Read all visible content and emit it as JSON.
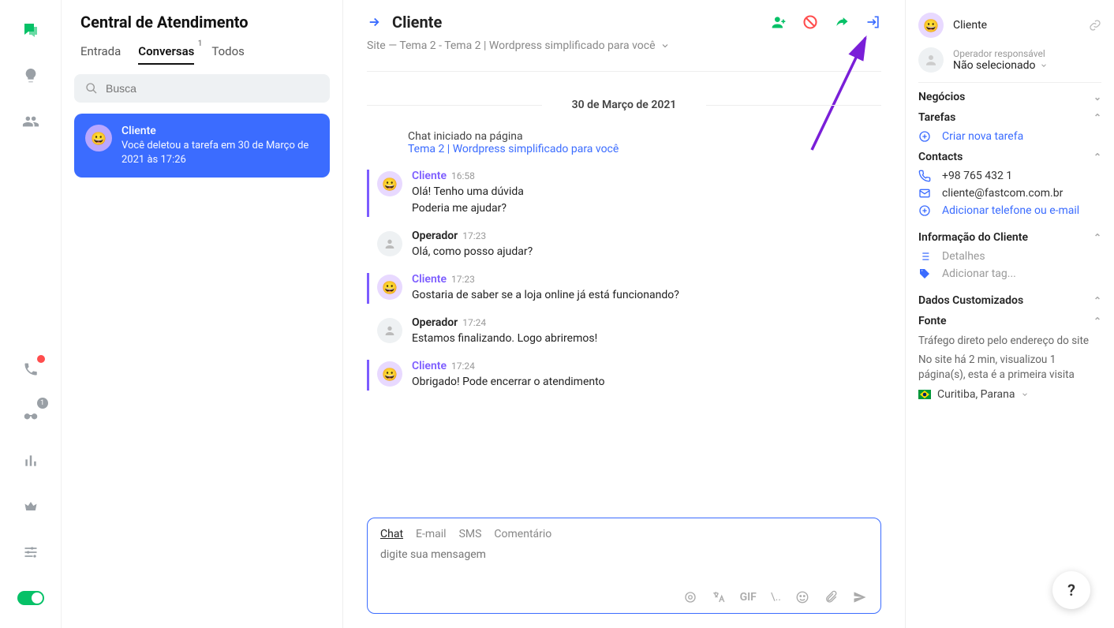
{
  "rail": {
    "binoculars_badge": "1"
  },
  "convs": {
    "title": "Central de Atendimento",
    "tabs": {
      "inbox": "Entrada",
      "conversations": "Conversas",
      "conv_badge": "1",
      "all": "Todos"
    },
    "search_placeholder": "Busca",
    "item": {
      "name": "Cliente",
      "preview": "Você deletou a tarefa em 30 de Março de 2021 às 17:26"
    }
  },
  "main": {
    "title": "Cliente",
    "breadcrumb": "Site — Tema 2 - Tema 2 | Wordpress simplificado para você",
    "date": "30 de Março de 2021",
    "sys": {
      "label": "Chat iniciado na página",
      "link": "Tema 2 | Wordpress simplificado para você"
    },
    "messages": [
      {
        "author": "Cliente",
        "role": "client",
        "time": "16:58",
        "text": "Olá! Tenho uma dúvida\nPoderia me ajudar?"
      },
      {
        "author": "Operador",
        "role": "operator",
        "time": "17:23",
        "text": "Olá, como posso ajudar?"
      },
      {
        "author": "Cliente",
        "role": "client",
        "time": "17:23",
        "text": "Gostaria de saber se a loja online já está funcionando?"
      },
      {
        "author": "Operador",
        "role": "operator",
        "time": "17:24",
        "text": "Estamos finalizando. Logo abriremos!"
      },
      {
        "author": "Cliente",
        "role": "client",
        "time": "17:24",
        "text": "Obrigado! Pode encerrar o atendimento"
      }
    ],
    "composer": {
      "tabs": {
        "chat": "Chat",
        "email": "E-mail",
        "sms": "SMS",
        "comment": "Comentário"
      },
      "placeholder": "digite sua mensagem",
      "gif": "GIF",
      "slash": "\\.."
    }
  },
  "info": {
    "client_name": "Cliente",
    "operator_label": "Operador responsável",
    "operator_value": "Não selecionado",
    "negocios": "Negócios",
    "tarefas": "Tarefas",
    "criar_tarefa": "Criar nova tarefa",
    "contacts": "Contacts",
    "phone": "+98 765 432 1",
    "email": "cliente@fastcom.com.br",
    "add_contact": "Adicionar telefone ou e-mail",
    "info_cliente": "Informação do Cliente",
    "detalhes": "Detalhes",
    "add_tag": "Adicionar tag...",
    "dados_custom": "Dados Customizados",
    "fonte": "Fonte",
    "fonte_line1": "Tráfego direto pelo endereço do site",
    "fonte_line2": "No site há 2 min, visualizou 1 página(s), esta é a primeira visita",
    "location": "Curitiba, Parana"
  },
  "help": "?"
}
